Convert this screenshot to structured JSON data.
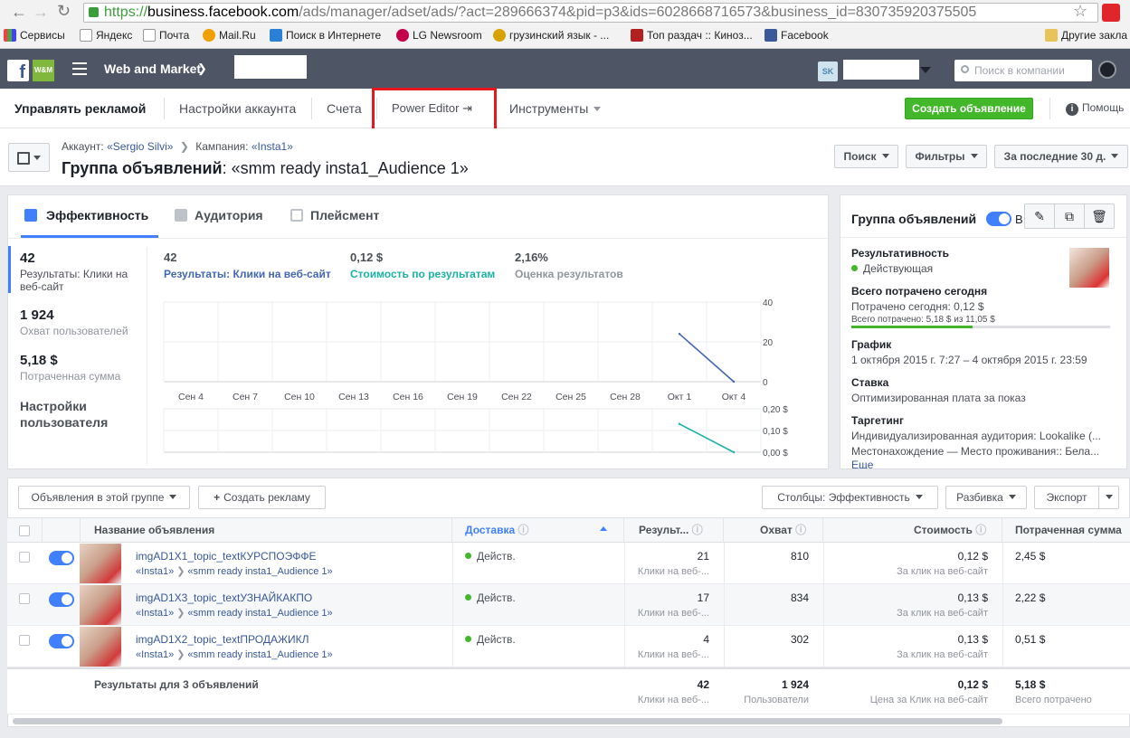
{
  "browser": {
    "url_prefix": "https://",
    "url_host": "business.facebook.com",
    "url_path": "/ads/manager/adset/ads/?act=289666374&pid=p3&ids=6028668716573&business_id=830735920375505",
    "bookmarks": [
      "Сервисы",
      "Яндекс",
      "Почта",
      "Mail.Ru",
      "Поиск в Интернете",
      "LG Newsroom",
      "грузинский язык - ...",
      "Топ раздач :: Киноз...",
      "Facebook",
      "Другие закла"
    ]
  },
  "fbbar": {
    "title": "Web and Market",
    "logo_text": "W&M",
    "avatar_text": "SK",
    "search_placeholder": "Поиск в компании"
  },
  "nav": {
    "items": [
      "Управлять рекламой",
      "Настройки аккаунта",
      "Счета",
      "Power Editor",
      "Инструменты"
    ],
    "create_button": "Создать объявление",
    "help": "Помощь"
  },
  "header": {
    "account_label": "Аккаунт:",
    "account_value": "«Sergio Silvi»",
    "campaign_label": "Кампания:",
    "campaign_value": "«Insta1»",
    "title_prefix": "Группа объявлений",
    "title_value": ": «smm ready insta1_Audience 1»",
    "search_btn": "Поиск",
    "filters_btn": "Фильтры",
    "period_btn": "За последние 30 д."
  },
  "perf": {
    "tabs": [
      "Эффективность",
      "Аудитория",
      "Плейсмент"
    ],
    "left_stats": [
      {
        "value": "42",
        "label": "Результаты: Клики на веб-сайт"
      },
      {
        "value": "1 924",
        "label": "Охват пользователей"
      },
      {
        "value": "5,18 $",
        "label": "Потраченная сумма"
      }
    ],
    "custom_settings": "Настройки пользователя",
    "top_stats": [
      {
        "value": "42",
        "label": "Результаты: Клики на веб-сайт",
        "color": "#4267b2"
      },
      {
        "value": "0,12 $",
        "label": "Стоимость по результатам",
        "color": "#1ab3a6"
      },
      {
        "value": "2,16%",
        "label": "Оценка результатов",
        "color": "#90949c"
      }
    ]
  },
  "chart_data": {
    "type": "line",
    "x": [
      "Сен 4",
      "Сен 7",
      "Сен 10",
      "Сен 13",
      "Сен 16",
      "Сен 19",
      "Сен 22",
      "Сен 25",
      "Сен 28",
      "Окт 1",
      "Окт 4"
    ],
    "series": [
      {
        "values": [
          null,
          null,
          null,
          null,
          null,
          null,
          null,
          null,
          null,
          24,
          0
        ],
        "color": "#4267b2",
        "ylim": [
          0,
          40
        ],
        "yticks": [
          "40",
          "20",
          "0"
        ]
      },
      {
        "values": [
          null,
          null,
          null,
          null,
          null,
          null,
          null,
          null,
          null,
          0.13,
          0
        ],
        "color": "#1ab3a6",
        "ylim": [
          0,
          0.2
        ],
        "yticks": [
          "0,20 $",
          "0,10 $",
          "0,00 $"
        ]
      }
    ]
  },
  "side": {
    "title": "Группа объявлений",
    "toggle_text": "В",
    "rows": [
      {
        "h": "Результативность",
        "t": "Действующая"
      },
      {
        "h": "Всего потрачено сегодня",
        "t": "Потрачено сегодня: 0,12 $",
        "t2": "Всего потрачено: 5,18 $ из 11,05 $",
        "progress": 0.47
      },
      {
        "h": "График",
        "t": "1 октября 2015 г. 7:27 – 4 октября 2015 г. 23:59"
      },
      {
        "h": "Ставка",
        "t": "Оптимизированная плата за показ"
      },
      {
        "h": "Таргетинг",
        "t": "Индивидуализированная аудитория: Lookalike (...",
        "t2": "Местонахождение — Место проживания:: Бела..."
      }
    ],
    "more": "Еще"
  },
  "table": {
    "toolbar": {
      "ads_in_group": "Объявления в этой группе",
      "create_ad": "Создать рекламу",
      "columns": "Столбцы: Эффективность",
      "breakdown": "Разбивка",
      "export": "Экспорт"
    },
    "headers": [
      "Название объявления",
      "Доставка",
      "Результ...",
      "Охват",
      "Стоимость",
      "Потраченная сумма"
    ],
    "rows": [
      {
        "name": "imgAD1X1_topic_textКУРСПОЭФФЕ",
        "campaign": "«Insta1»",
        "adset": "«smm ready insta1_Audience 1»",
        "delivery": "Действ.",
        "results": "21",
        "results_sub": "Клики на веб-...",
        "reach": "810",
        "cost": "0,12 $",
        "cost_sub": "За клик на веб-сайт",
        "spent": "2,45 $"
      },
      {
        "name": "imgAD1X3_topic_textУЗНАЙКАКПО",
        "campaign": "«Insta1»",
        "adset": "«smm ready insta1_Audience 1»",
        "delivery": "Действ.",
        "results": "17",
        "results_sub": "Клики на веб-...",
        "reach": "834",
        "cost": "0,13 $",
        "cost_sub": "За клик на веб-сайт",
        "spent": "2,22 $"
      },
      {
        "name": "imgAD1X2_topic_textПРОДАЖИКЛ",
        "campaign": "«Insta1»",
        "adset": "«smm ready insta1_Audience 1»",
        "delivery": "Действ.",
        "results": "4",
        "results_sub": "Клики на веб-...",
        "reach": "302",
        "cost": "0,13 $",
        "cost_sub": "За клик на веб-сайт",
        "spent": "0,51 $"
      }
    ],
    "total": {
      "label": "Результаты для 3 объявлений",
      "results": "42",
      "results_sub": "Клики на веб-...",
      "reach": "1 924",
      "reach_sub": "Пользователи",
      "cost": "0,12 $",
      "cost_sub": "Цена за Клик на веб-сайт",
      "spent": "5,18 $",
      "spent_sub": "Всего потрачено"
    }
  }
}
